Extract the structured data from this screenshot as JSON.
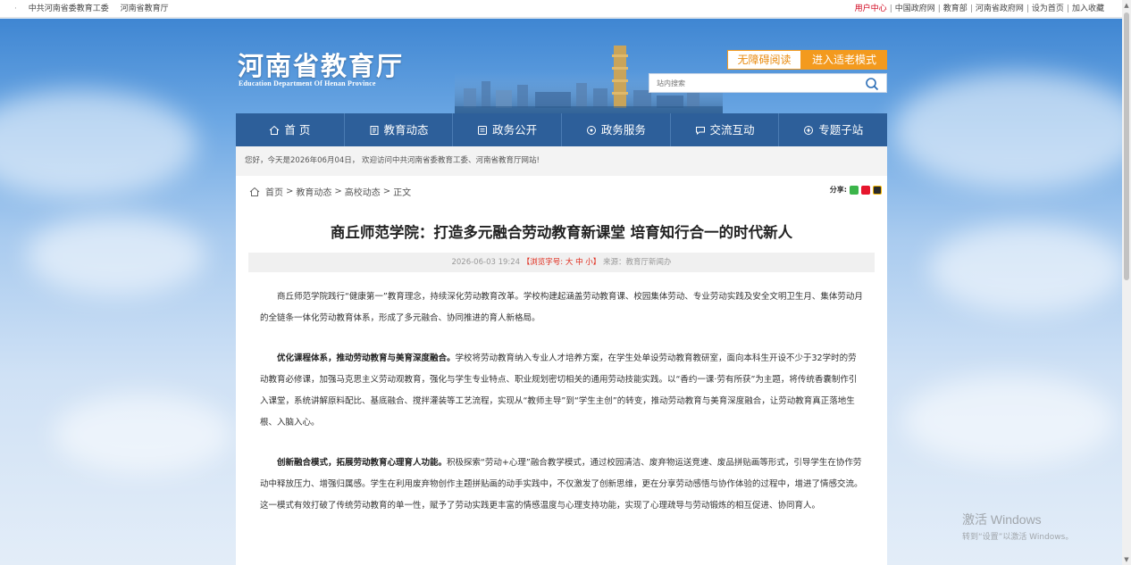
{
  "topbar": {
    "left_links": [
      "中共河南省委教育工委",
      "河南省教育厅"
    ],
    "right_links": [
      "用户中心",
      "中国政府网",
      "教育部",
      "河南省政府网",
      "设为首页",
      "加入收藏"
    ],
    "separator": "|"
  },
  "header": {
    "logo_cn": "河南省教育厅",
    "logo_en": "Education Department Of Henan Province",
    "accessible_btn": "无障碍阅读",
    "elder_btn": "进入适老模式",
    "search_placeholder": "站内搜索"
  },
  "nav": {
    "items": [
      {
        "label": "首 页",
        "icon": "home-icon"
      },
      {
        "label": "教育动态",
        "icon": "news-icon"
      },
      {
        "label": "政务公开",
        "icon": "document-icon"
      },
      {
        "label": "政务服务",
        "icon": "service-icon"
      },
      {
        "label": "交流互动",
        "icon": "chat-icon"
      },
      {
        "label": "专题子站",
        "icon": "topic-icon"
      }
    ]
  },
  "greeting": "您好，今天是2026年06月04日， 欢迎访问中共河南省委教育工委、河南省教育厅网站!",
  "breadcrumb": {
    "items": [
      "首页",
      "教育动态",
      "高校动态",
      "正文"
    ],
    "sep": ">"
  },
  "share_label": "分享:",
  "article": {
    "title": "商丘师范学院：打造多元融合劳动教育新课堂 培育知行合一的时代新人",
    "date": "2026-06-03 19:24",
    "font_size_label": "【浏览字号: 大 中 小】",
    "source": "来源：教育厅新闻办",
    "p1": "商丘师范学院践行“健康第一”教育理念，持续深化劳动教育改革。学校构建起涵盖劳动教育课、校园集体劳动、专业劳动实践及安全文明卫生月、集体劳动月的全链条一体化劳动教育体系，形成了多元融合、协同推进的育人新格局。",
    "p2_bold": "优化课程体系，推动劳动教育与美育深度融合。",
    "p2_rest": "学校将劳动教育纳入专业人才培养方案，在学生处单设劳动教育教研室，面向本科生开设不少于32学时的劳动教育必修课，加强马克思主义劳动观教育，强化与学生专业特点、职业规划密切相关的通用劳动技能实践。以“香约一课·劳有所获”为主题，将传统香囊制作引入课堂，系统讲解原料配比、基底融合、搅拌灌装等工艺流程，实现从“教师主导”到“学生主创”的转变，推动劳动教育与美育深度融合，让劳动教育真正落地生根、入脑入心。",
    "p3_bold": "创新融合模式，拓展劳动教育心理育人功能。",
    "p3_rest": "积极探索“劳动+心理”融合教学模式，通过校园清洁、废弃物运送竞速、废品拼贴画等形式，引导学生在协作劳动中释放压力、增强归属感。学生在利用废弃物创作主题拼贴画的动手实践中，不仅激发了创新思维，更在分享劳动感悟与协作体验的过程中，增进了情感交流。这一模式有效打破了传统劳动教育的单一性，赋予了劳动实践更丰富的情感温度与心理支持功能，实现了心理疏导与劳动锻炼的相互促进、协同育人。"
  },
  "watermark": {
    "line1": "激活 Windows",
    "line2": "转到“设置”以激活 Windows。"
  },
  "colors": {
    "nav_bg": "#2d5f9a",
    "accent_orange": "#f39a1e",
    "link_red": "#d0021b"
  }
}
